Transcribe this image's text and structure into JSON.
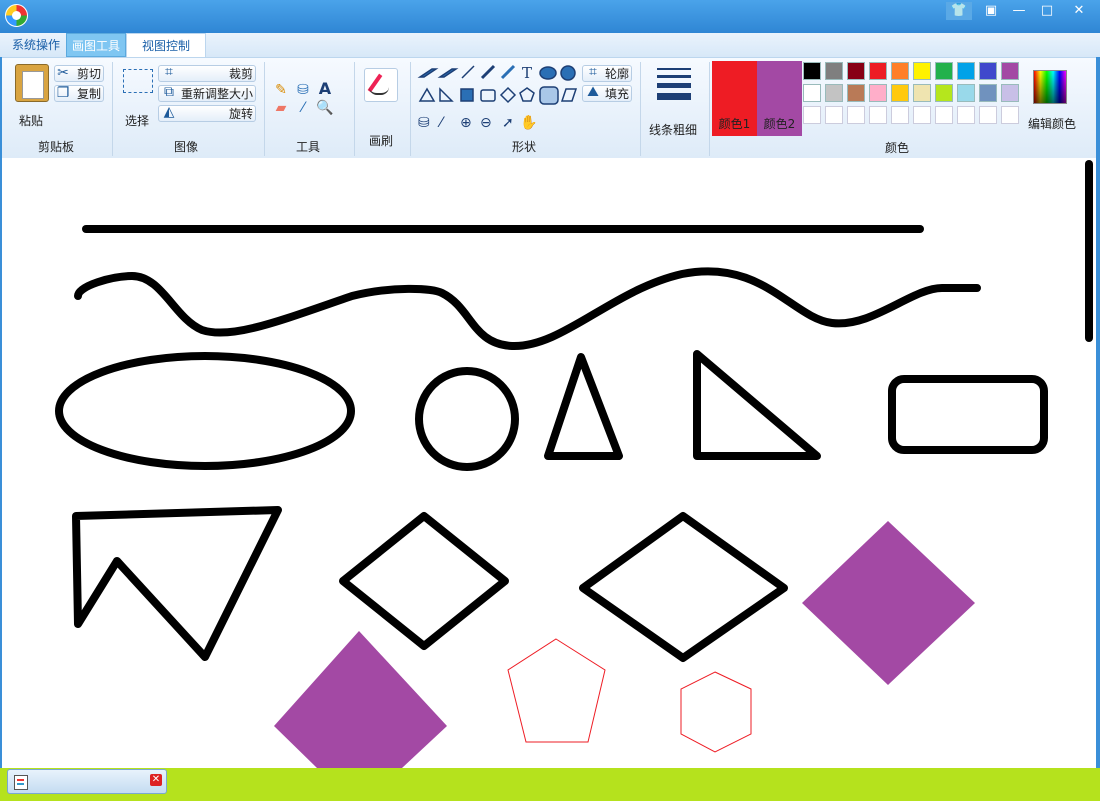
{
  "window": {
    "controls": [
      "👕",
      "▣",
      "—",
      "□",
      "✕"
    ]
  },
  "tabs": [
    {
      "label": "系统操作"
    },
    {
      "label": "画图工具"
    },
    {
      "label": "视图控制"
    }
  ],
  "clipboard": {
    "paste_label": "粘贴",
    "cut_label": "剪切",
    "copy_label": "复制",
    "group_label": "剪贴板"
  },
  "image": {
    "select_label": "选择",
    "crop_label": "裁剪",
    "resize_label": "重新调整大小",
    "rotate_label": "旋转",
    "group_label": "图像"
  },
  "tools": {
    "group_label": "工具"
  },
  "brushes": {
    "group_label": "画刷"
  },
  "shapes": {
    "outline_label": "轮廓",
    "fill_label": "填充",
    "group_label": "形状"
  },
  "line_width": {
    "label": "线条粗细"
  },
  "colors": {
    "color1_label": "颜色1",
    "color2_label": "颜色2",
    "color1_value": "#ee1c24",
    "color2_value": "#a349a4",
    "edit_label": "编辑颜色",
    "group_label": "颜色",
    "palette_row1": [
      "#000000",
      "#7f7f7f",
      "#880015",
      "#ed1c24",
      "#ff7f27",
      "#fff200",
      "#22b14c",
      "#00a2e8",
      "#3f48cc",
      "#a349a4"
    ],
    "palette_row2": [
      "#ffffff",
      "#c3c3c3",
      "#b97a57",
      "#ffaec9",
      "#ffc90e",
      "#efe4b0",
      "#b5e61d",
      "#99d9ea",
      "#7092be",
      "#c8bfe7"
    ],
    "palette_row3": [
      "#ffffff",
      "#ffffff",
      "#ffffff",
      "#ffffff",
      "#ffffff",
      "#ffffff",
      "#ffffff",
      "#ffffff",
      "#ffffff",
      "#ffffff"
    ]
  },
  "canvas": {
    "stroke_color": "#000000",
    "fill_color": "#a349a4",
    "outline_color": "#ee1c24"
  }
}
